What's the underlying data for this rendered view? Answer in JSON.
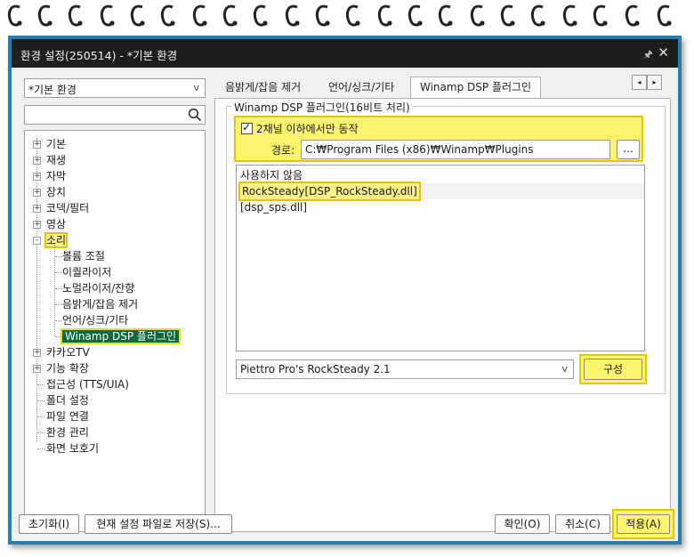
{
  "window": {
    "title": "환경 설정(250514) - *기본 환경",
    "pin_label": "🖈",
    "close_label": "✕"
  },
  "left": {
    "preset_value": "*기본 환경",
    "preset_arrow": "v",
    "tree": {
      "top": [
        "기본",
        "재생",
        "자막",
        "장치",
        "코덱/필터",
        "영상",
        "소리"
      ],
      "sound_children": [
        "볼륨 조절",
        "이퀄라이저",
        "노멀라이저/잔향",
        "음밝게/잡음 제거",
        "언어/싱크/기타",
        "Winamp DSP 플러그인"
      ],
      "after": [
        "카카오TV",
        "기능 확장"
      ],
      "leaves": [
        "접근성 (TTS/UIA)",
        "폴더 설정",
        "파일 연결",
        "환경 관리",
        "화면 보호기"
      ]
    }
  },
  "tabs": [
    "음밝게/잡음 제거",
    "언어/싱크/기타",
    "Winamp DSP 플러그인"
  ],
  "tab_nav": {
    "prev": "◂",
    "next": "▸"
  },
  "group": {
    "legend": "Winamp DSP 플러그인(16비트 처리)",
    "checkbox_label": "2채널 이하에서만 동작",
    "checkbox_checked": true,
    "path_label": "경로:",
    "path_value": "C:₩Program Files (x86)₩Winamp₩Plugins",
    "browse_label": "...",
    "plugins": [
      "사용하지 않음",
      "RockSteady[DSP_RockSteady.dll]",
      "[dsp_sps.dll]"
    ],
    "selected_plugin": "RockSteady[DSP_RockSteady.dll]",
    "module_value": "Piettro Pro's RockSteady 2.1",
    "module_arrow": "v",
    "configure_label": "구성"
  },
  "buttons": {
    "reset": "초기화(I)",
    "save_as": "현재 설정 파일로 저장(S)...",
    "ok": "확인(O)",
    "cancel": "취소(C)",
    "apply": "적용(A)"
  },
  "colors": {
    "frame": "#2a7db0",
    "titlebar": "#1e1e1e",
    "highlight": "#fcf46e",
    "selected_tree": "#0a6a3a"
  }
}
